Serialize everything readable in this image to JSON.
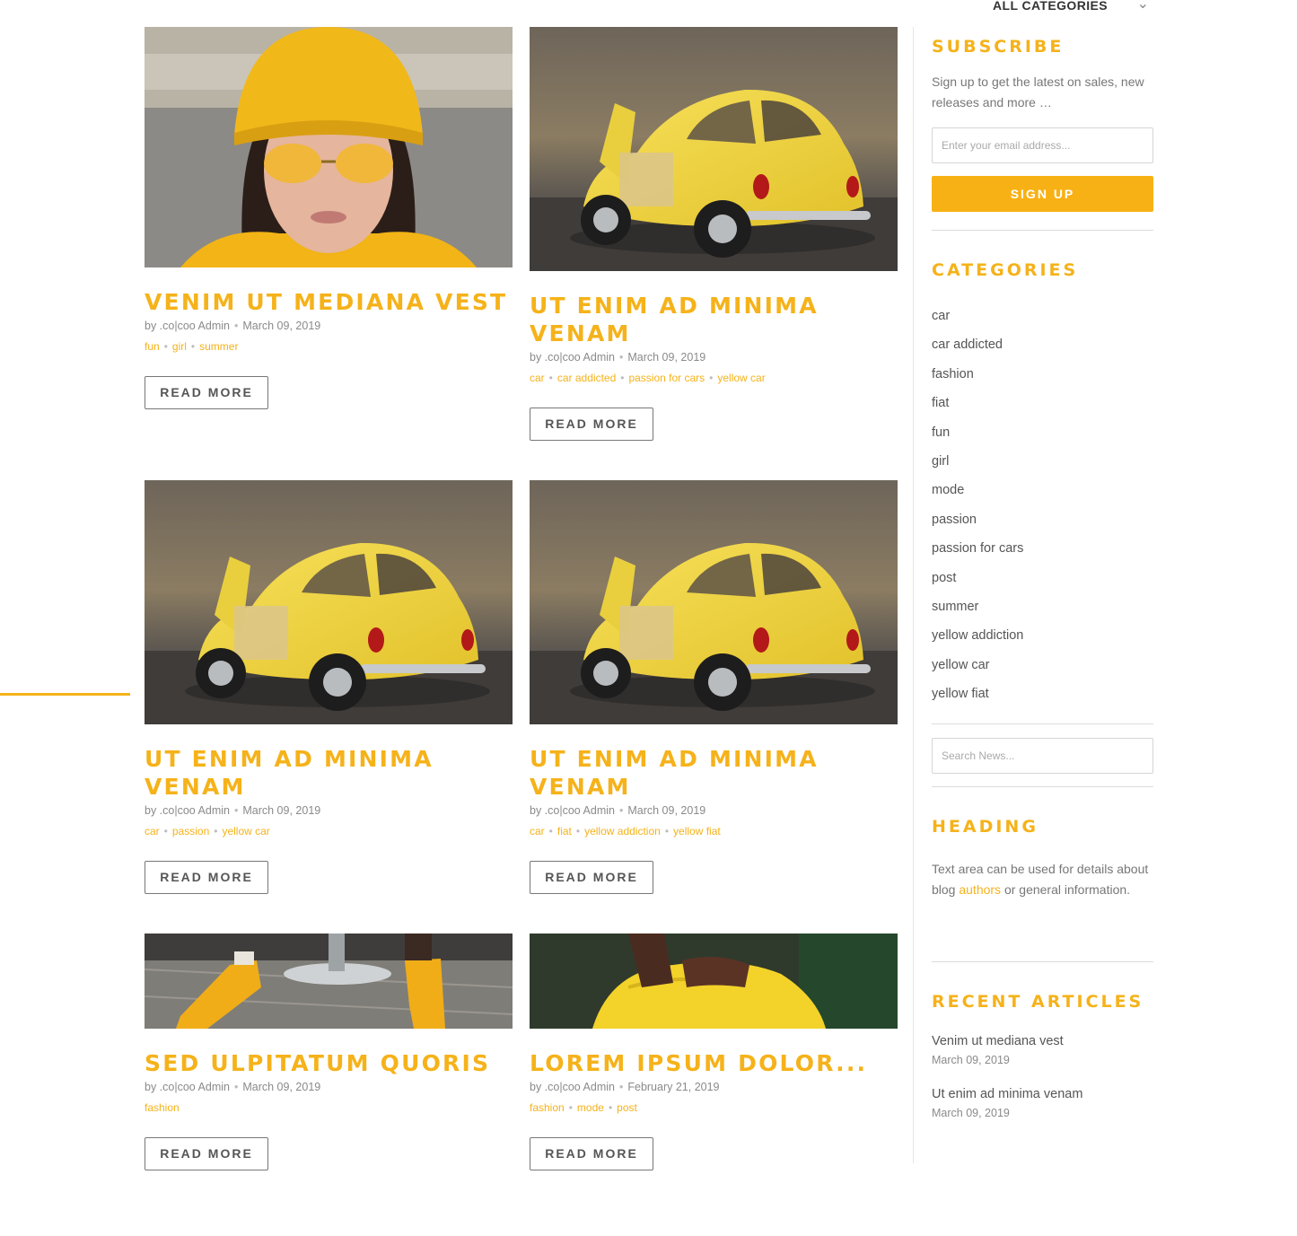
{
  "header": {
    "categories_select": "ALL CATEGORIES"
  },
  "posts": [
    {
      "title": "VENIM UT MEDIANA VEST",
      "author": "by .co|coo Admin",
      "date": "March 09, 2019",
      "tags": [
        "fun",
        "girl",
        "summer"
      ],
      "cta": "READ MORE",
      "image": "woman-yellow-beanie"
    },
    {
      "title": "UT ENIM AD MINIMA VENAM",
      "author": "by .co|coo Admin",
      "date": "March 09, 2019",
      "tags": [
        "car",
        "car addicted",
        "passion for cars",
        "yellow car"
      ],
      "cta": "READ MORE",
      "image": "yellow-beetle"
    },
    {
      "title": "UT ENIM AD MINIMA VENAM",
      "author": "by .co|coo Admin",
      "date": "March 09, 2019",
      "tags": [
        "car",
        "passion",
        "yellow car"
      ],
      "cta": "READ MORE",
      "image": "yellow-beetle"
    },
    {
      "title": "UT ENIM AD MINIMA VENAM",
      "author": "by .co|coo Admin",
      "date": "March 09, 2019",
      "tags": [
        "car",
        "fiat",
        "yellow addiction",
        "yellow fiat"
      ],
      "cta": "READ MORE",
      "image": "yellow-beetle"
    },
    {
      "title": "SED ULPITATUM QUORIS",
      "author": "by .co|coo Admin",
      "date": "March 09, 2019",
      "tags": [
        "fashion"
      ],
      "cta": "READ MORE",
      "image": "yellow-boots"
    },
    {
      "title": "LOREM IPSUM DOLOR...",
      "author": "by .co|coo Admin",
      "date": "February 21, 2019",
      "tags": [
        "fashion",
        "mode",
        "post"
      ],
      "cta": "READ MORE",
      "image": "yellow-dress"
    }
  ],
  "sidebar": {
    "subscribe": {
      "title": "SUBSCRIBE",
      "text": "Sign up to get the latest on sales, new releases and more …",
      "email_placeholder": "Enter your email address...",
      "button": "SIGN UP"
    },
    "categories": {
      "title": "CATEGORIES",
      "items": [
        "car",
        "car addicted",
        "fashion",
        "fiat",
        "fun",
        "girl",
        "mode",
        "passion",
        "passion for cars",
        "post",
        "summer",
        "yellow addiction",
        "yellow car",
        "yellow fiat"
      ]
    },
    "search": {
      "placeholder": "Search News..."
    },
    "heading": {
      "title": "HEADING",
      "text_before": "Text area can be used for details about blog ",
      "link": "authors",
      "text_after": " or general information."
    },
    "recent": {
      "title": "RECENT ARTICLES",
      "items": [
        {
          "title": "Venim ut mediana vest",
          "date": "March 09, 2019"
        },
        {
          "title": "Ut enim ad minima venam",
          "date": "March 09, 2019"
        }
      ]
    }
  },
  "colors": {
    "accent": "#f5b21a",
    "button": "#f8b114"
  }
}
